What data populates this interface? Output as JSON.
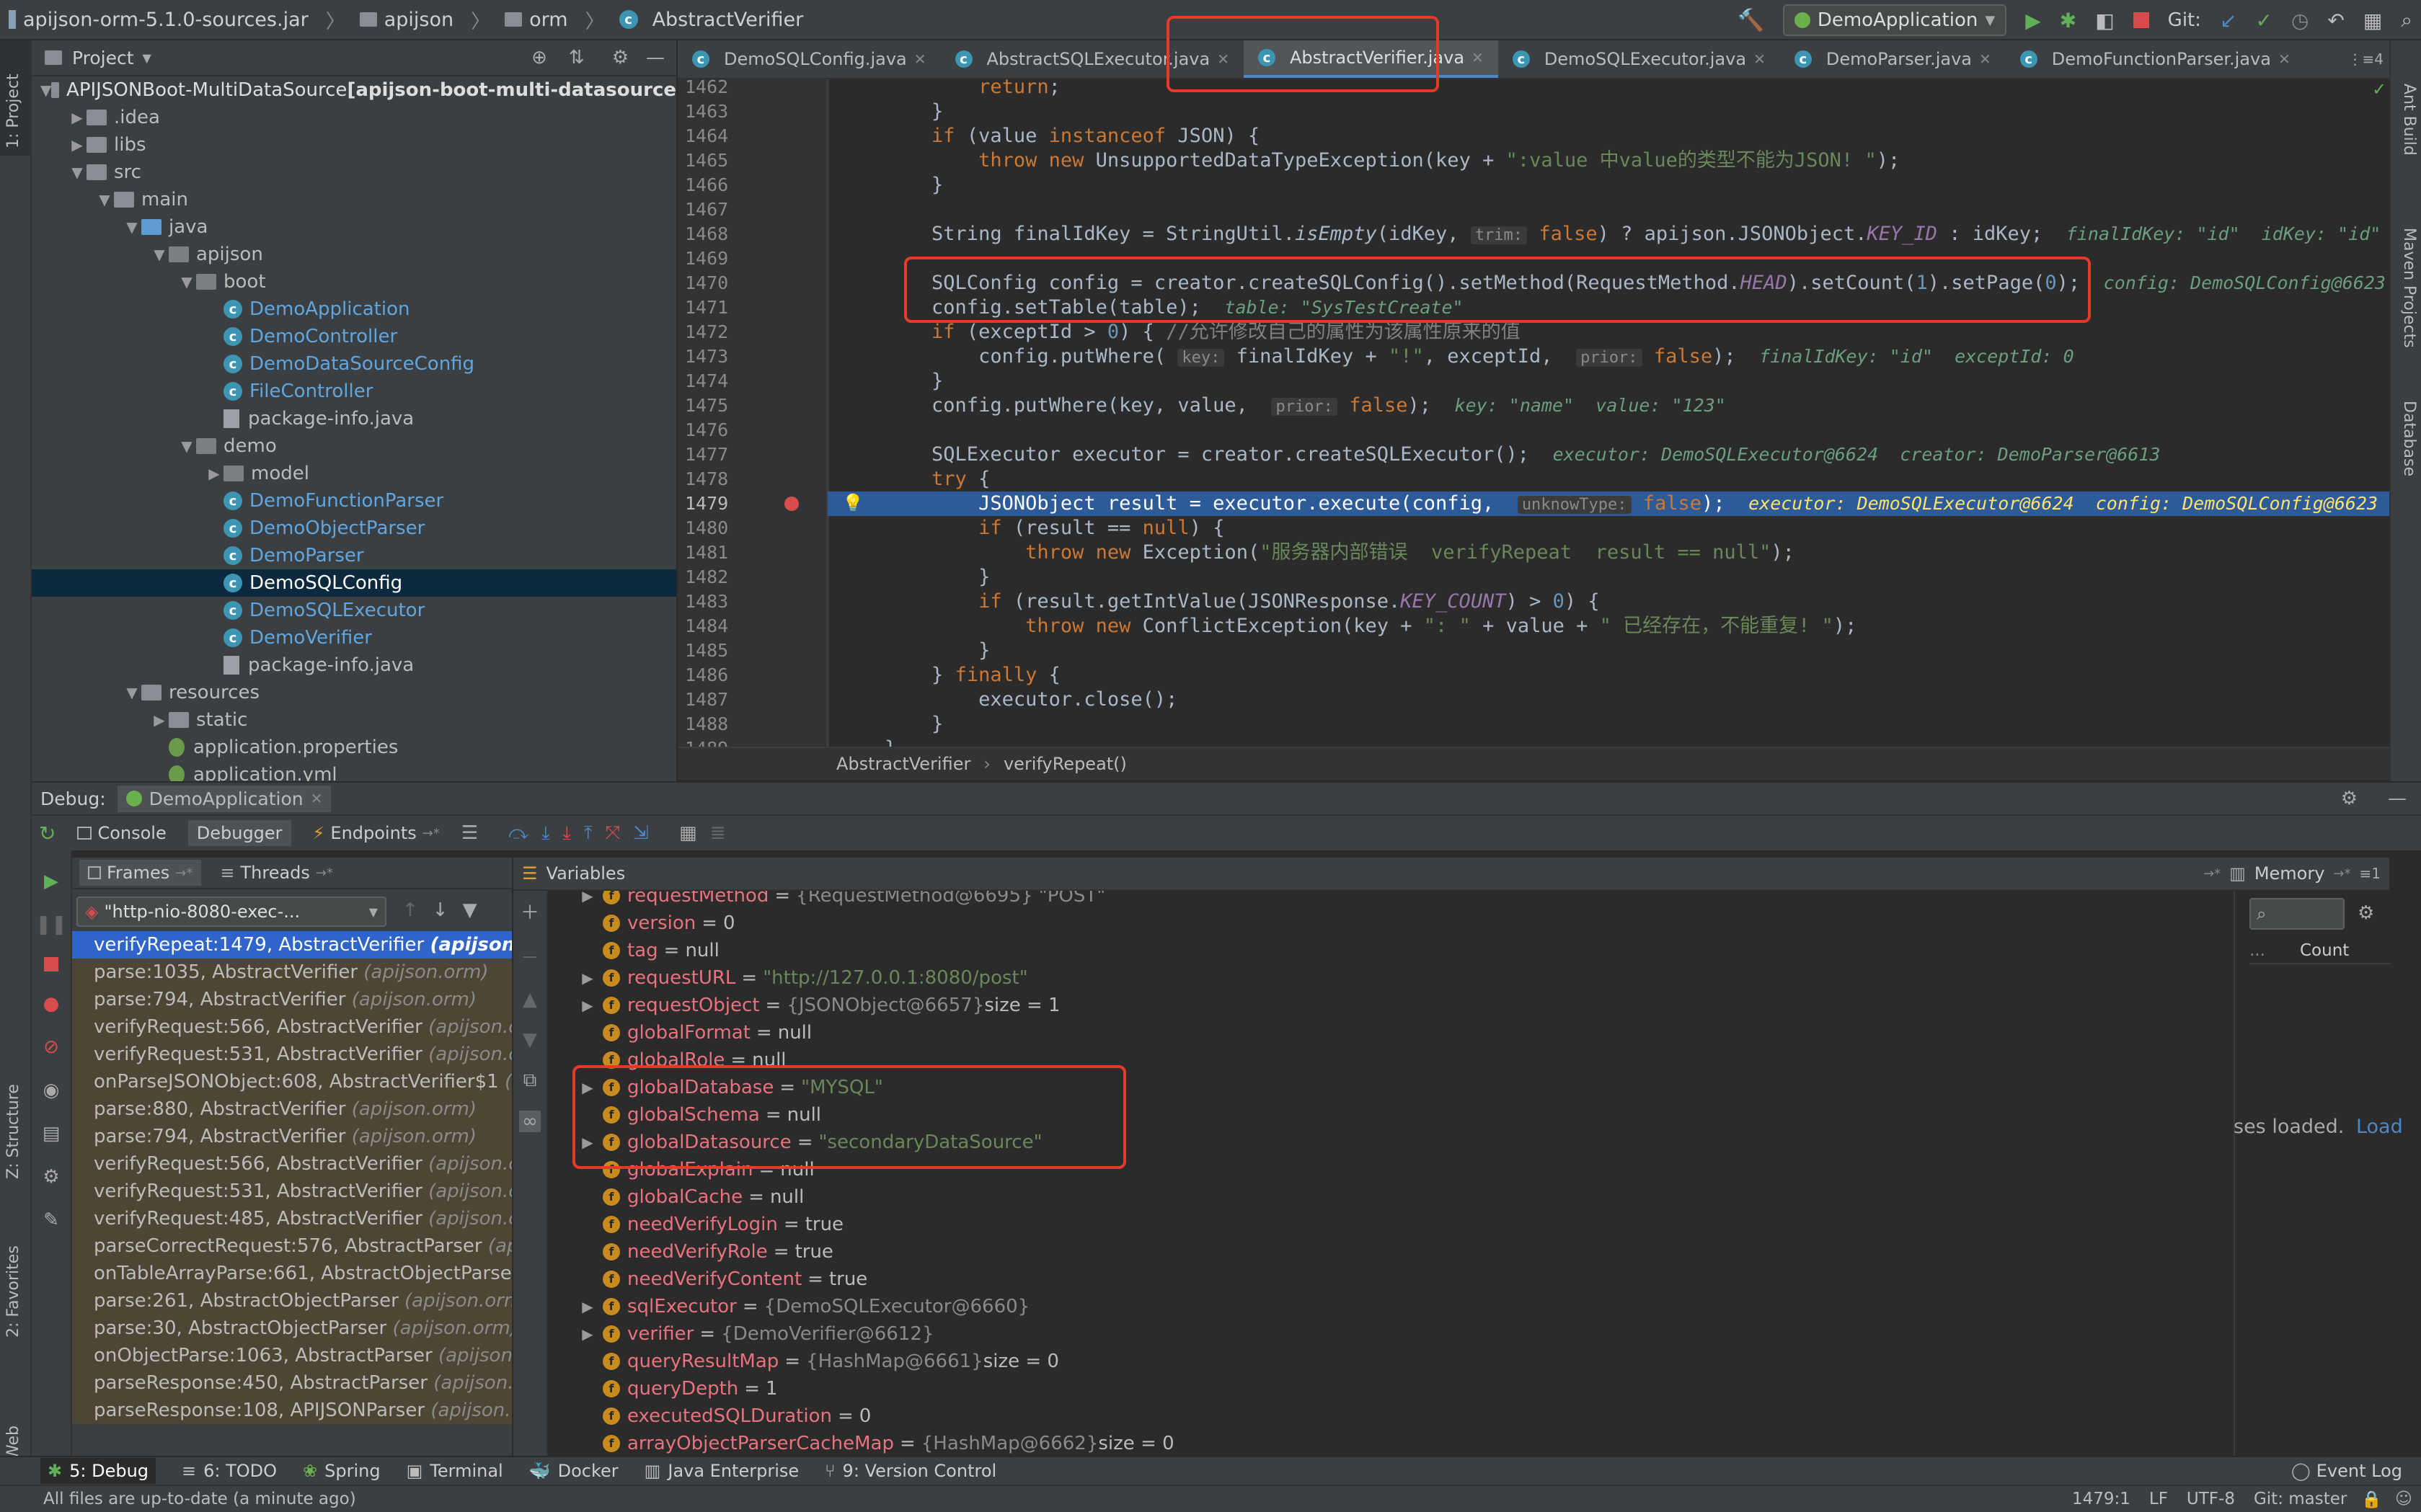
{
  "navbar": {
    "crumbs": [
      "apijson-orm-5.1.0-sources.jar",
      "apijson",
      "orm",
      "AbstractVerifier"
    ],
    "run_config": "DemoApplication",
    "git_label": "Git:"
  },
  "left_strip": {
    "project": "1: Project",
    "structure": "Z: Structure",
    "favorites": "2: Favorites",
    "web": "Web"
  },
  "right_strip": {
    "ant": "Ant Build",
    "maven": "Maven Projects",
    "database": "Database"
  },
  "project": {
    "title": "Project",
    "rows": [
      {
        "text": "APIJSONBoot-MultiDataSource",
        "extra": " [apijson-boot-multi-datasource",
        "level": 0,
        "kind": "folder",
        "caret": "open"
      },
      {
        "text": ".idea",
        "level": 1,
        "kind": "folder",
        "caret": "closed"
      },
      {
        "text": "libs",
        "level": 1,
        "kind": "folder",
        "caret": "closed"
      },
      {
        "text": "src",
        "level": 1,
        "kind": "folder",
        "caret": "open"
      },
      {
        "text": "main",
        "level": 2,
        "kind": "folder",
        "caret": "open"
      },
      {
        "text": "java",
        "level": 3,
        "kind": "folder-blue",
        "caret": "open"
      },
      {
        "text": "apijson",
        "level": 4,
        "kind": "pkg",
        "caret": "open"
      },
      {
        "text": "boot",
        "level": 5,
        "kind": "pkg",
        "caret": "open"
      },
      {
        "text": "DemoApplication",
        "level": 6,
        "kind": "class"
      },
      {
        "text": "DemoController",
        "level": 6,
        "kind": "class"
      },
      {
        "text": "DemoDataSourceConfig",
        "level": 6,
        "kind": "class"
      },
      {
        "text": "FileController",
        "level": 6,
        "kind": "class"
      },
      {
        "text": "package-info.java",
        "level": 6,
        "kind": "file"
      },
      {
        "text": "demo",
        "level": 5,
        "kind": "pkg",
        "caret": "open"
      },
      {
        "text": "model",
        "level": 6,
        "kind": "pkg",
        "caret": "closed"
      },
      {
        "text": "DemoFunctionParser",
        "level": 6,
        "kind": "class"
      },
      {
        "text": "DemoObjectParser",
        "level": 6,
        "kind": "class"
      },
      {
        "text": "DemoParser",
        "level": 6,
        "kind": "class"
      },
      {
        "text": "DemoSQLConfig",
        "level": 6,
        "kind": "class",
        "selected": true
      },
      {
        "text": "DemoSQLExecutor",
        "level": 6,
        "kind": "class"
      },
      {
        "text": "DemoVerifier",
        "level": 6,
        "kind": "class"
      },
      {
        "text": "package-info.java",
        "level": 6,
        "kind": "file"
      },
      {
        "text": "resources",
        "level": 3,
        "kind": "folder",
        "caret": "open"
      },
      {
        "text": "static",
        "level": 4,
        "kind": "folder",
        "caret": "closed"
      },
      {
        "text": "application.properties",
        "level": 4,
        "kind": "leaf"
      },
      {
        "text": "application.yml",
        "level": 4,
        "kind": "leaf"
      }
    ]
  },
  "tabs": [
    {
      "label": "DemoSQLConfig.java",
      "active": false
    },
    {
      "label": "AbstractSQLExecutor.java",
      "active": false
    },
    {
      "label": "AbstractVerifier.java",
      "active": true
    },
    {
      "label": "DemoSQLExecutor.java",
      "active": false
    },
    {
      "label": "DemoParser.java",
      "active": false
    },
    {
      "label": "DemoFunctionParser.java",
      "active": false
    }
  ],
  "tabs_overflow": "4",
  "editor": {
    "line_numbers": [
      "1462",
      "1463",
      "1464",
      "1465",
      "1466",
      "1467",
      "1468",
      "1469",
      "1470",
      "1471",
      "1472",
      "1473",
      "1474",
      "1475",
      "1476",
      "1477",
      "1478",
      "1479",
      "1480",
      "1481",
      "1482",
      "1483",
      "1484",
      "1485",
      "1486",
      "1487",
      "1488",
      "1489"
    ],
    "lines": [
      [
        {
          "t": "            "
        },
        {
          "t": "return",
          "c": "kw"
        },
        {
          "t": ";"
        }
      ],
      [
        {
          "t": "        }"
        }
      ],
      [
        {
          "t": "        "
        },
        {
          "t": "if",
          "c": "kw"
        },
        {
          "t": " (value "
        },
        {
          "t": "instanceof",
          "c": "kw"
        },
        {
          "t": " JSON) {"
        }
      ],
      [
        {
          "t": "            "
        },
        {
          "t": "throw new",
          "c": "kw"
        },
        {
          "t": " UnsupportedDataTypeException(key + "
        },
        {
          "t": "\":value 中value的类型不能为JSON! \"",
          "c": "str"
        },
        {
          "t": ");"
        }
      ],
      [
        {
          "t": "        }"
        }
      ],
      [
        {
          "t": ""
        }
      ],
      [
        {
          "t": "        String finalIdKey = StringUtil."
        },
        {
          "t": "isEmpty",
          "c": "it"
        },
        {
          "t": "(idKey, "
        },
        {
          "t": "trim:",
          "c": "hint"
        },
        {
          "t": " "
        },
        {
          "t": "false",
          "c": "kw"
        },
        {
          "t": ") ? apijson.JSONObject."
        },
        {
          "t": "KEY_ID",
          "c": "fld"
        },
        {
          "t": " : idKey;  "
        },
        {
          "t": "finalIdKey: \"id\"  idKey: \"id\"",
          "c": "dbg"
        }
      ],
      [
        {
          "t": ""
        }
      ],
      [
        {
          "t": "        SQLConfig config = creator.createSQLConfig().setMethod(RequestMethod."
        },
        {
          "t": "HEAD",
          "c": "fld"
        },
        {
          "t": ").setCount("
        },
        {
          "t": "1",
          "c": "num"
        },
        {
          "t": ").setPage("
        },
        {
          "t": "0",
          "c": "num"
        },
        {
          "t": ");  "
        },
        {
          "t": "config: DemoSQLConfig@6623",
          "c": "dbg"
        }
      ],
      [
        {
          "t": "        config.setTable(table);  "
        },
        {
          "t": "table: \"SysTestCreate\"",
          "c": "dbg"
        }
      ],
      [
        {
          "t": "        "
        },
        {
          "t": "if",
          "c": "kw"
        },
        {
          "t": " (exceptId > "
        },
        {
          "t": "0",
          "c": "num"
        },
        {
          "t": ") { "
        },
        {
          "t": "//允许修改自己的属性为该属性原来的值",
          "c": "cmt"
        }
      ],
      [
        {
          "t": "            config.putWhere( "
        },
        {
          "t": "key:",
          "c": "hint"
        },
        {
          "t": " finalIdKey + "
        },
        {
          "t": "\"!\"",
          "c": "str"
        },
        {
          "t": ", exceptId,  "
        },
        {
          "t": "prior:",
          "c": "hint"
        },
        {
          "t": " "
        },
        {
          "t": "false",
          "c": "kw"
        },
        {
          "t": ");  "
        },
        {
          "t": "finalIdKey: \"id\"  exceptId: 0",
          "c": "dbg"
        }
      ],
      [
        {
          "t": "        }"
        }
      ],
      [
        {
          "t": "        config.putWhere(key, value,  "
        },
        {
          "t": "prior:",
          "c": "hint"
        },
        {
          "t": " "
        },
        {
          "t": "false",
          "c": "kw"
        },
        {
          "t": ");  "
        },
        {
          "t": "key: \"name\"  value: \"123\"",
          "c": "dbg"
        }
      ],
      [
        {
          "t": ""
        }
      ],
      [
        {
          "t": "        SQLExecutor executor = creator.createSQLExecutor();  "
        },
        {
          "t": "executor: DemoSQLExecutor@6624  creator: DemoParser@6613",
          "c": "dbg"
        }
      ],
      [
        {
          "t": "        "
        },
        {
          "t": "try",
          "c": "kw"
        },
        {
          "t": " {"
        }
      ],
      [
        {
          "t": "            JSONObject result = executor.execute(config,  "
        },
        {
          "t": "unknowType:",
          "c": "hint"
        },
        {
          "t": " "
        },
        {
          "t": "false",
          "c": "kw"
        },
        {
          "t": ");  "
        },
        {
          "t": "executor: DemoSQLExecutor@6624  config: DemoSQLConfig@6623",
          "c": "dbg-hl"
        }
      ],
      [
        {
          "t": "            "
        },
        {
          "t": "if",
          "c": "kw"
        },
        {
          "t": " (result == "
        },
        {
          "t": "null",
          "c": "kw"
        },
        {
          "t": ") {"
        }
      ],
      [
        {
          "t": "                "
        },
        {
          "t": "throw new",
          "c": "kw"
        },
        {
          "t": " Exception("
        },
        {
          "t": "\"服务器内部错误  verifyRepeat  result == null\"",
          "c": "str"
        },
        {
          "t": ");"
        }
      ],
      [
        {
          "t": "            }"
        }
      ],
      [
        {
          "t": "            "
        },
        {
          "t": "if",
          "c": "kw"
        },
        {
          "t": " (result.getIntValue(JSONResponse."
        },
        {
          "t": "KEY_COUNT",
          "c": "fld"
        },
        {
          "t": ") > "
        },
        {
          "t": "0",
          "c": "num"
        },
        {
          "t": ") {"
        }
      ],
      [
        {
          "t": "                "
        },
        {
          "t": "throw new",
          "c": "kw"
        },
        {
          "t": " ConflictException(key + "
        },
        {
          "t": "\": \"",
          "c": "str"
        },
        {
          "t": " + value + "
        },
        {
          "t": "\" 已经存在，不能重复! \"",
          "c": "str"
        },
        {
          "t": ");"
        }
      ],
      [
        {
          "t": "            }"
        }
      ],
      [
        {
          "t": "        } "
        },
        {
          "t": "finally",
          "c": "kw"
        },
        {
          "t": " {"
        }
      ],
      [
        {
          "t": "            executor.close();"
        }
      ],
      [
        {
          "t": "        }"
        }
      ],
      [
        {
          "t": "    }"
        }
      ]
    ],
    "highlight_index": 17,
    "breakpoint_index": 17
  },
  "editor_breadcrumb": [
    "AbstractVerifier",
    "verifyRepeat()"
  ],
  "debug": {
    "label": "Debug:",
    "session": "DemoApplication",
    "tabs": [
      "Console",
      "Debugger",
      "Endpoints"
    ],
    "frames_label": "Frames",
    "threads_label": "Threads",
    "thread_select": "\"http-nio-8080-exec-...",
    "frames": [
      {
        "m": "verifyRepeat:1479, AbstractVerifier ",
        "p": "(apijson.or",
        "sel": true
      },
      {
        "m": "parse:1035, AbstractVerifier ",
        "p": "(apijson.orm)"
      },
      {
        "m": "parse:794, AbstractVerifier ",
        "p": "(apijson.orm)"
      },
      {
        "m": "verifyRequest:566, AbstractVerifier ",
        "p": "(apijson.or"
      },
      {
        "m": "verifyRequest:531, AbstractVerifier ",
        "p": "(apijson.or"
      },
      {
        "m": "onParseJSONObject:608, AbstractVerifier$1 ",
        "p": "(a"
      },
      {
        "m": "parse:880, AbstractVerifier ",
        "p": "(apijson.orm)"
      },
      {
        "m": "parse:794, AbstractVerifier ",
        "p": "(apijson.orm)"
      },
      {
        "m": "verifyRequest:566, AbstractVerifier ",
        "p": "(apijson.or"
      },
      {
        "m": "verifyRequest:531, AbstractVerifier ",
        "p": "(apijson.or"
      },
      {
        "m": "verifyRequest:485, AbstractVerifier ",
        "p": "(apijson.or"
      },
      {
        "m": "parseCorrectRequest:576, AbstractParser ",
        "p": "(apij"
      },
      {
        "m": "onTableArrayParse:661, AbstractObjectParser",
        "p": ""
      },
      {
        "m": "parse:261, AbstractObjectParser ",
        "p": "(apijson.orm"
      },
      {
        "m": "parse:30, AbstractObjectParser ",
        "p": "(apijson.orm)"
      },
      {
        "m": "onObjectParse:1063, AbstractParser ",
        "p": "(apijson.o"
      },
      {
        "m": "parseResponse:450, AbstractParser ",
        "p": "(apijson.o"
      },
      {
        "m": "parseResponse:108, APIJSONParser ",
        "p": "(apijson.fr"
      }
    ],
    "variables_label": "Variables",
    "memory_label": "Memory",
    "count_label": "Count",
    "classes_loaded": "ses loaded.",
    "load_link": "Load",
    "variables": [
      {
        "name": "requestMethod",
        "val": "{RequestMethod@6695} \"POST\"",
        "kind": "ref",
        "caret": true
      },
      {
        "name": "version",
        "val": "0",
        "kind": "plain"
      },
      {
        "name": "tag",
        "val": "null",
        "kind": "plain"
      },
      {
        "name": "requestURL",
        "val": "\"http://127.0.0.1:8080/post\"",
        "kind": "str",
        "caret": true
      },
      {
        "name": "requestObject",
        "val": "{JSONObject@6657}",
        "extra": " size = 1",
        "kind": "ref",
        "caret": true
      },
      {
        "name": "globalFormat",
        "val": "null",
        "kind": "plain"
      },
      {
        "name": "globalRole",
        "val": "null",
        "kind": "plain"
      },
      {
        "name": "globalDatabase",
        "val": "\"MYSQL\"",
        "kind": "str",
        "caret": true
      },
      {
        "name": "globalSchema",
        "val": "null",
        "kind": "plain"
      },
      {
        "name": "globalDatasource",
        "val": "\"secondaryDataSource\"",
        "kind": "str",
        "caret": true
      },
      {
        "name": "globalExplain",
        "val": "null",
        "kind": "plain"
      },
      {
        "name": "globalCache",
        "val": "null",
        "kind": "plain"
      },
      {
        "name": "needVerifyLogin",
        "val": "true",
        "kind": "plain"
      },
      {
        "name": "needVerifyRole",
        "val": "true",
        "kind": "plain"
      },
      {
        "name": "needVerifyContent",
        "val": "true",
        "kind": "plain"
      },
      {
        "name": "sqlExecutor",
        "val": "{DemoSQLExecutor@6660}",
        "kind": "ref",
        "caret": true
      },
      {
        "name": "verifier",
        "val": "{DemoVerifier@6612}",
        "kind": "ref",
        "caret": true
      },
      {
        "name": "queryResultMap",
        "val": "{HashMap@6661}",
        "extra": " size = 0",
        "kind": "ref"
      },
      {
        "name": "queryDepth",
        "val": "1",
        "kind": "plain"
      },
      {
        "name": "executedSQLDuration",
        "val": "0",
        "kind": "plain"
      },
      {
        "name": "arrayObjectParserCacheMap",
        "val": "{HashMap@6662}",
        "extra": " size = 0",
        "kind": "ref"
      }
    ]
  },
  "bottom_tabs": [
    "5: Debug",
    "6: TODO",
    "Spring",
    "Terminal",
    "Docker",
    "Java Enterprise",
    "9: Version Control"
  ],
  "event_log": "Event Log",
  "status": {
    "message": "All files are up-to-date (a minute ago)",
    "position": "1479:1",
    "line_sep": "LF",
    "encoding": "UTF-8",
    "git": "Git: master"
  },
  "colors": {
    "accent": "#4a88c7",
    "annotation": "#e53a2a",
    "selection": "#2f65ca"
  }
}
